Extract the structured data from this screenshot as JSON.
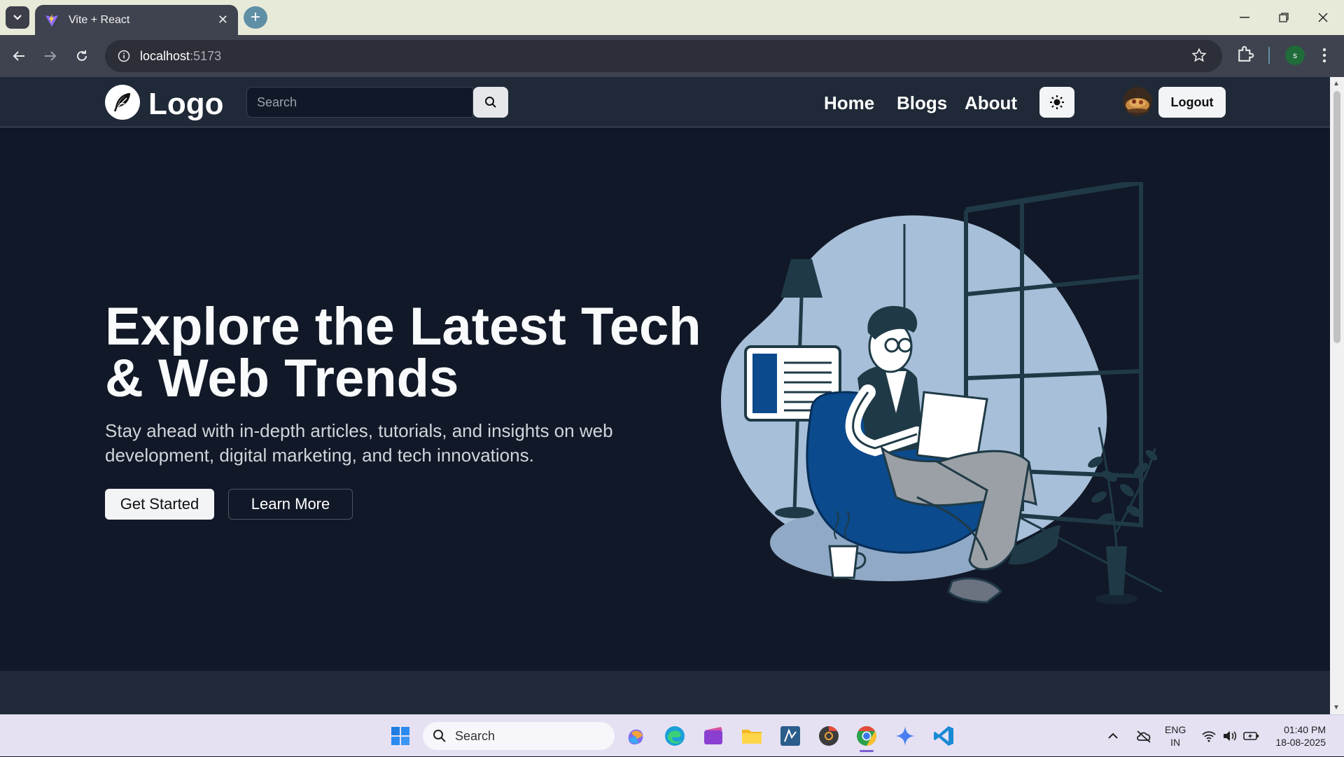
{
  "browser": {
    "tab_title": "Vite + React",
    "url_host": "localhost",
    "url_port": ":5173",
    "profile_initial": "s"
  },
  "site": {
    "logo_text": "Logo",
    "search_placeholder": "Search",
    "nav": [
      {
        "label": "Home"
      },
      {
        "label": "Blogs"
      },
      {
        "label": "About"
      }
    ],
    "logout_label": "Logout"
  },
  "hero": {
    "title_line1": "Explore the Latest Tech",
    "title_line2": "& Web Trends",
    "subtitle": "Stay ahead with in-depth articles, tutorials, and insights on web development, digital marketing, and tech innovations.",
    "primary_cta": "Get Started",
    "secondary_cta": "Learn More"
  },
  "taskbar": {
    "search_label": "Search",
    "lang_line1": "ENG",
    "lang_line2": "IN",
    "time": "01:40 PM",
    "date": "18-08-2025"
  },
  "colors": {
    "page_bg": "#111827",
    "navbar_bg": "#1f2937",
    "illustration_blue": "#0b4a8c",
    "illustration_light": "#a7bfd8"
  }
}
